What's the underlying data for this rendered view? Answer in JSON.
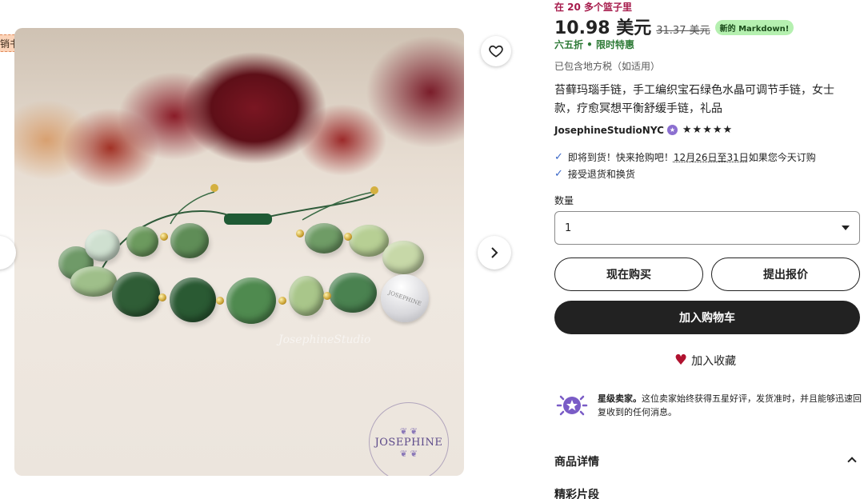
{
  "badges": {
    "bestseller": "销书"
  },
  "listing": {
    "basket_note": "在 20 多个篮子里",
    "price": "10.98 美元",
    "original_price": "31.37 美元",
    "markdown_badge": "新的 Markdown!",
    "discount_note": "六五折 • 限时特惠",
    "tax_note": "已包含地方税（如适用）",
    "title": "苔藓玛瑙手链，手工编织宝石绿色水晶可调节手链，女士款，疗愈冥想平衡舒缓手链，礼品",
    "seller_name": "JosephineStudioNYC",
    "rating_stars": "★★★★★"
  },
  "perks": {
    "arrival_prefix": "即将到货！快来抢购吧！",
    "arrival_dates": "12月26日至31日",
    "arrival_suffix": "如果您今天订购",
    "returns": "接受退货和换货"
  },
  "quantity": {
    "label": "数量",
    "value": "1"
  },
  "actions": {
    "buy_now": "现在购买",
    "make_offer": "提出报价",
    "add_to_cart": "加入购物车",
    "add_to_favorites": "加入收藏"
  },
  "star_seller": {
    "title": "星级卖家。",
    "description": "这位卖家始终获得五星好评，发货准时，并且能够迅速回复收到的任何消息。"
  },
  "sections": {
    "item_details": "商品详情",
    "highlights": "精彩片段"
  },
  "image": {
    "watermark": "JosephineStudio",
    "logo_text": "JOSEPHINE",
    "charm_text": "JOSEPHINE"
  },
  "colors": {
    "accent": "#a61a4b",
    "discount": "#2d7a36",
    "cart_button": "#222222",
    "heart": "#b0122f"
  }
}
